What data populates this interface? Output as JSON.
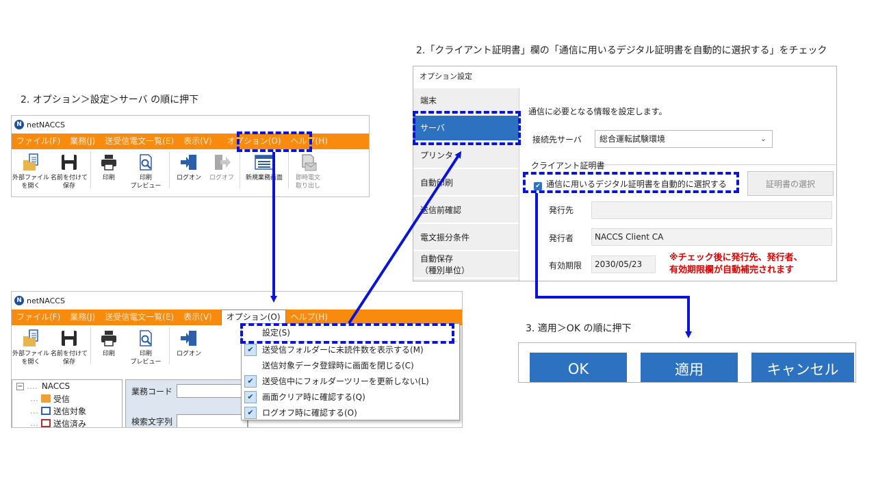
{
  "captions": {
    "step_option": "2. オプション＞設定＞サーバ の順に押下",
    "step_client_cert": "2.「クライアント証明書」欄の「通信に用いるデジタル証明書を自動的に選択する」をチェック",
    "step_apply": "3. 適用＞OK の順に押下"
  },
  "app": {
    "title": "netNACCS",
    "menu": [
      "ファイル(F)",
      "業務(J)",
      "送受信電文一覧(E)",
      "表示(V)",
      "オプション(O)",
      "ヘルプ(H)"
    ],
    "toolbar": {
      "open_external": [
        "外部ファイル",
        "を開く"
      ],
      "save_as": [
        "名前を付けて",
        "保存"
      ],
      "print": "印刷",
      "print_preview": [
        "印刷",
        "プレビュー"
      ],
      "logon": "ログオン",
      "logoff": "ログオフ",
      "new_task": "新規業務画面",
      "instant_retrieve": [
        "即時電文",
        "取り出し"
      ]
    },
    "tree": {
      "root": "NACCS",
      "items": [
        "受信",
        "送信対象",
        "送信済み"
      ]
    },
    "form": {
      "task_code_label": "業務コード",
      "search_label": "検索文字列"
    },
    "option_menu": {
      "settings": "設定(S)",
      "items": [
        "送受信フォルダーに未読件数を表示する(M)",
        "送信対象データ登録時に画面を閉じる(C)",
        "送受信中にフォルダーツリーを更新しない(L)",
        "画面クリア時に確認する(Q)",
        "ログオフ時に確認する(O)"
      ]
    }
  },
  "options_dialog": {
    "title": "オプション設定",
    "nav": [
      "端末",
      "サーバ",
      "プリンタ",
      "自動印刷",
      "送信前確認",
      "電文振分条件",
      "自動保存",
      "（種別単位）"
    ],
    "description": "通信に必要となる情報を設定します。",
    "server_label": "接続先サーバ",
    "server_value": "総合運転試験環境",
    "client_cert_group": "クライアント証明書",
    "auto_select_label": "通信に用いるデジタル証明書を自動的に選択する",
    "auto_select_checked": true,
    "select_cert_button": "証明書の選択",
    "issued_to_label": "発行先",
    "issued_to_value": "",
    "issuer_label": "発行者",
    "issuer_value": "NACCS Client CA",
    "expiry_label": "有効期限",
    "expiry_value": "2030/05/23",
    "note_line1": "※チェック後に発行先、発行者、",
    "note_line2": "有効期限欄が自動補完されます"
  },
  "dialog_buttons": {
    "ok": "OK",
    "apply": "適用",
    "cancel": "キャンセル"
  },
  "colors": {
    "menubar": "#f88a0e",
    "selected": "#2d72c0",
    "highlight": "#0a14d8",
    "note": "#e00000"
  }
}
